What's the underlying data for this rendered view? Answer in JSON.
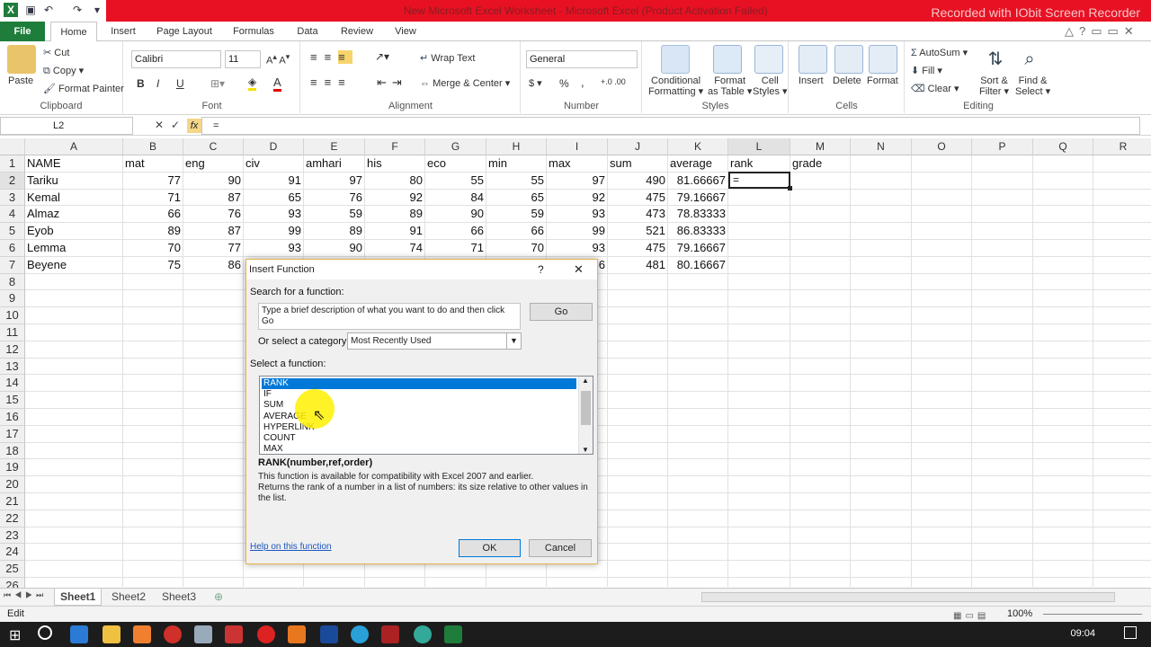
{
  "window": {
    "title": "New Microsoft Excel Worksheet  -  Microsoft Excel (Product Activation Failed)",
    "watermark": "Recorded with IObit Screen Recorder",
    "colors": {
      "title_bar": "#e81123",
      "file_tab": "#1f7d3c",
      "selection": "#0078d7"
    }
  },
  "ribbon": {
    "tabs": [
      "File",
      "Home",
      "Insert",
      "Page Layout",
      "Formulas",
      "Data",
      "Review",
      "View"
    ],
    "clipboard": {
      "paste": "Paste",
      "cut": "Cut",
      "copy": "Copy ▾",
      "format_painter": "Format Painter",
      "label": "Clipboard"
    },
    "font": {
      "name": "Calibri",
      "size": "11",
      "bold": "B",
      "italic": "I",
      "underline": "U",
      "label": "Font"
    },
    "alignment": {
      "wrap_text": "Wrap Text",
      "merge_center": "Merge & Center ▾",
      "label": "Alignment"
    },
    "number": {
      "format": "General",
      "currency": "$ ▾",
      "percent": "%",
      "comma": ",",
      "label": "Number"
    },
    "styles": {
      "conditional": "Conditional\nFormatting ▾",
      "format_table": "Format\nas Table ▾",
      "cell_styles": "Cell\nStyles ▾",
      "label": "Styles"
    },
    "cells": {
      "insert": "Insert",
      "delete": "Delete",
      "format": "Format",
      "label": "Cells"
    },
    "editing": {
      "autosum": "AutoSum ▾",
      "fill": "Fill ▾",
      "clear": "Clear ▾",
      "sort_filter": "Sort &\nFilter ▾",
      "find_select": "Find &\nSelect ▾",
      "label": "Editing"
    }
  },
  "formula_bar": {
    "name_box": "L2",
    "cancel": "✕",
    "enter": "✓",
    "fx": "fx",
    "formula": "="
  },
  "sheet": {
    "columns": [
      "A",
      "B",
      "C",
      "D",
      "E",
      "F",
      "G",
      "H",
      "I",
      "J",
      "K",
      "L",
      "M",
      "N",
      "O",
      "P",
      "Q",
      "R"
    ],
    "rows": [
      "1",
      "2",
      "3",
      "4",
      "5",
      "6",
      "7",
      "8",
      "9",
      "10",
      "11",
      "12",
      "13",
      "14",
      "15",
      "16",
      "17",
      "18",
      "19",
      "20",
      "21",
      "22",
      "23",
      "24",
      "25",
      "26"
    ],
    "headers": [
      "NAME",
      "mat",
      "eng",
      "civ",
      "amhari",
      "his",
      "eco",
      "min",
      "max",
      "sum",
      "average",
      "rank",
      "grade"
    ],
    "data": [
      [
        "Tariku",
        "77",
        "90",
        "91",
        "97",
        "80",
        "55",
        "55",
        "97",
        "490",
        "81.66667"
      ],
      [
        "Kemal",
        "71",
        "87",
        "65",
        "76",
        "92",
        "84",
        "65",
        "92",
        "475",
        "79.16667"
      ],
      [
        "Almaz",
        "66",
        "76",
        "93",
        "59",
        "89",
        "90",
        "59",
        "93",
        "473",
        "78.83333"
      ],
      [
        "Eyob",
        "89",
        "87",
        "99",
        "89",
        "91",
        "66",
        "66",
        "99",
        "521",
        "86.83333"
      ],
      [
        "Lemma",
        "70",
        "77",
        "93",
        "90",
        "74",
        "71",
        "70",
        "93",
        "475",
        "79.16667"
      ],
      [
        "Beyene",
        "75",
        "86",
        "",
        "",
        "",
        "",
        "",
        "6",
        "481",
        "80.16667"
      ]
    ],
    "active_cell_value": "=",
    "sheet_tabs": [
      "Sheet1",
      "Sheet2",
      "Sheet3"
    ]
  },
  "status_bar": {
    "mode": "Edit",
    "zoom": "100%"
  },
  "taskbar": {
    "time": "09:04"
  },
  "dialog": {
    "title": "Insert Function",
    "help": "?",
    "close": "✕",
    "search_label": "Search for a function:",
    "search_value": "Type a brief description of what you want to do and then click Go",
    "go": "Go",
    "category_label": "Or select a category:",
    "category_value": "Most Recently Used",
    "select_label": "Select a function:",
    "functions": [
      "RANK",
      "IF",
      "SUM",
      "AVERAGE",
      "HYPERLINK",
      "COUNT",
      "MAX"
    ],
    "selected_function": "RANK",
    "signature": "RANK(number,ref,order)",
    "description1": "This function is available for compatibility with Excel 2007 and earlier.",
    "description2": "Returns the rank of a number in a list of numbers: its size relative to other values in the list.",
    "help_link": "Help on this function",
    "ok": "OK",
    "cancel": "Cancel"
  }
}
